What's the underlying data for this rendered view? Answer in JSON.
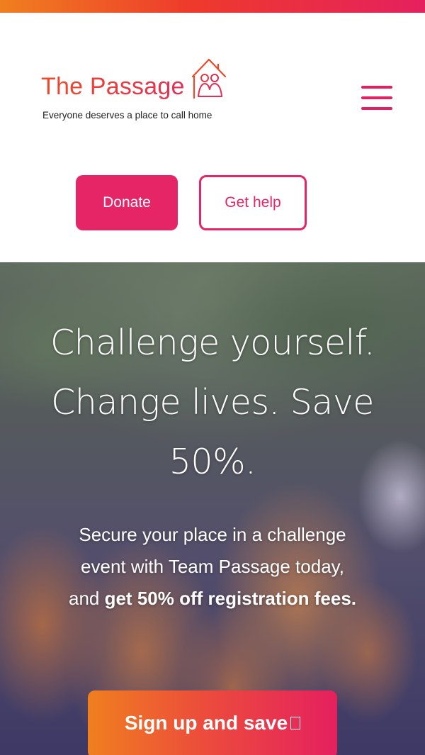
{
  "brand": {
    "name": "The Passage",
    "tagline": "Everyone deserves a place to call home",
    "logo_icon": "house-people-icon",
    "colors": {
      "primary": "#e52565",
      "orange": "#f07f1f",
      "red": "#ee3a2c"
    }
  },
  "header": {
    "menu_icon": "hamburger-menu-icon",
    "donate_label": "Donate",
    "get_help_label": "Get help"
  },
  "hero": {
    "title": "Challenge yourself. Change lives. Save 50%.",
    "body_regular": "Secure your place in a challenge event with Team Passage today, and ",
    "body_bold": "get 50% off registration fees.",
    "cta_label": "Sign up and save",
    "cta_icon": "external-link-icon"
  }
}
